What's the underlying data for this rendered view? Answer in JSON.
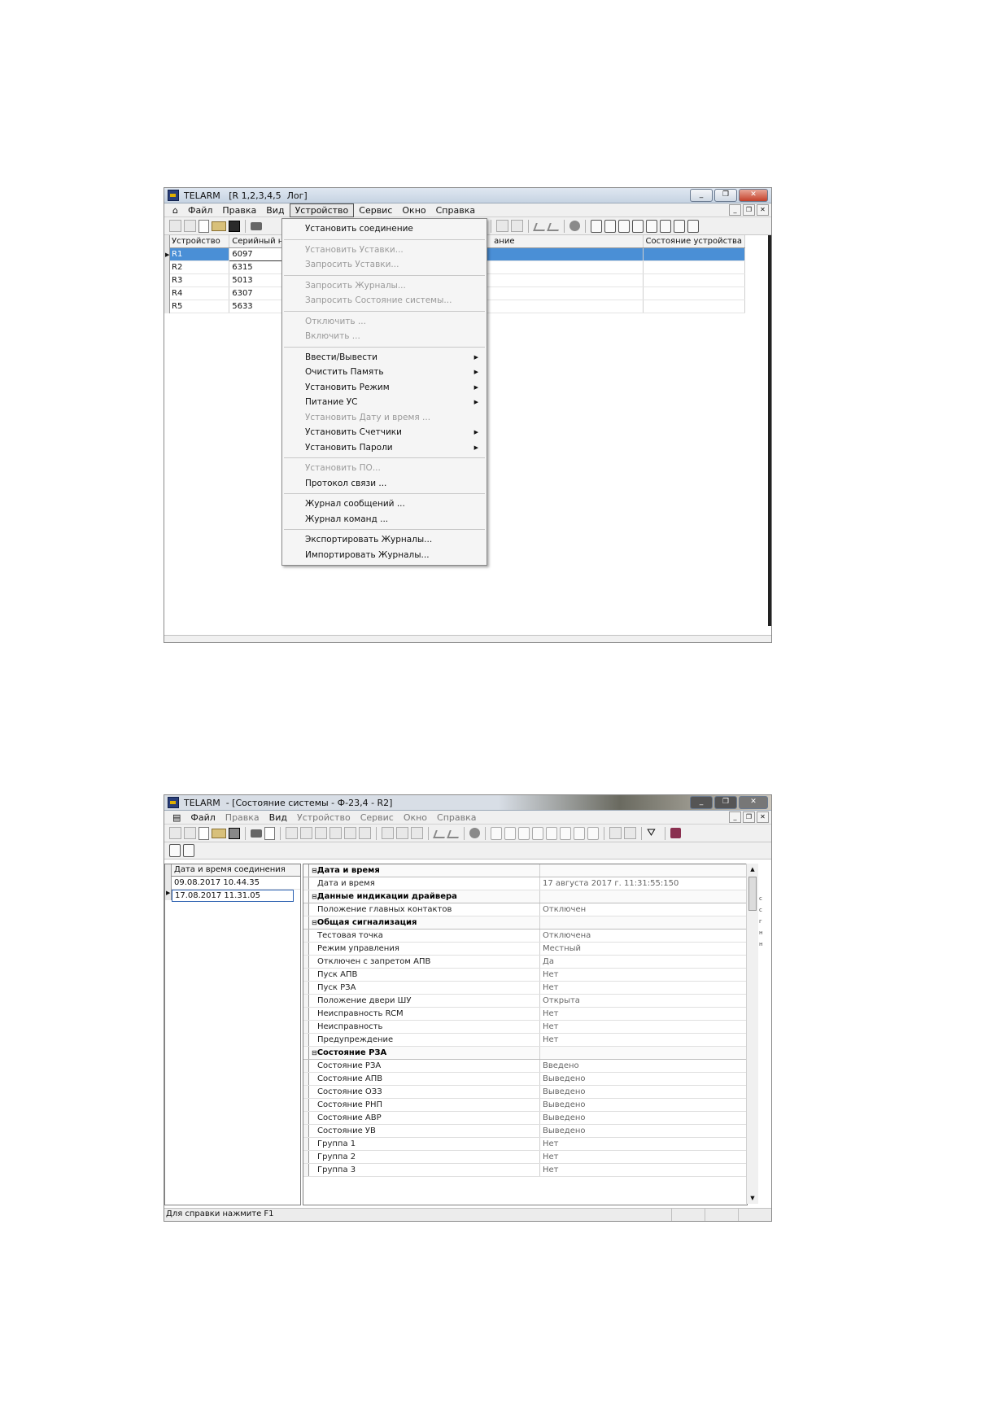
{
  "window1": {
    "title": "TELARM   [R 1,2,3,4,5  Лог]",
    "menu": [
      "Файл",
      "Правка",
      "Вид",
      "Устройство",
      "Сервис",
      "Окно",
      "Справка"
    ],
    "table": {
      "headers": [
        "Устройство",
        "Серийный н",
        "ание",
        "Состояние устройства"
      ],
      "rows": [
        {
          "device": "R1",
          "serial": "6097"
        },
        {
          "device": "R2",
          "serial": "6315"
        },
        {
          "device": "R3",
          "serial": "5013"
        },
        {
          "device": "R4",
          "serial": "6307"
        },
        {
          "device": "R5",
          "serial": "5633"
        }
      ]
    },
    "dropdown": [
      {
        "label": "Установить соединение",
        "disabled": false,
        "submenu": false
      },
      {
        "sep": true
      },
      {
        "label": "Установить Уставки...",
        "disabled": true,
        "submenu": false
      },
      {
        "label": "Запросить Уставки...",
        "disabled": true,
        "submenu": false
      },
      {
        "sep": true
      },
      {
        "label": "Запросить Журналы...",
        "disabled": true,
        "submenu": false
      },
      {
        "label": "Запросить Состояние системы...",
        "disabled": true,
        "submenu": false
      },
      {
        "sep": true
      },
      {
        "label": "Отключить ...",
        "disabled": true,
        "submenu": false
      },
      {
        "label": "Включить ...",
        "disabled": true,
        "submenu": false
      },
      {
        "sep": true
      },
      {
        "label": "Ввести/Вывести",
        "disabled": false,
        "submenu": true
      },
      {
        "label": "Очистить Память",
        "disabled": false,
        "submenu": true
      },
      {
        "label": "Установить Режим",
        "disabled": false,
        "submenu": true
      },
      {
        "label": "Питание УС",
        "disabled": false,
        "submenu": true
      },
      {
        "label": "Установить Дату и время ...",
        "disabled": true,
        "submenu": false
      },
      {
        "label": "Установить Счетчики",
        "disabled": false,
        "submenu": true
      },
      {
        "label": "Установить Пароли",
        "disabled": false,
        "submenu": true
      },
      {
        "sep": true
      },
      {
        "label": "Установить ПО...",
        "disabled": true,
        "submenu": false
      },
      {
        "label": "Протокол связи ...",
        "disabled": false,
        "submenu": false
      },
      {
        "sep": true
      },
      {
        "label": "Журнал сообщений ...",
        "disabled": false,
        "submenu": false
      },
      {
        "label": "Журнал команд ...",
        "disabled": false,
        "submenu": false
      },
      {
        "sep": true
      },
      {
        "label": "Экспортировать Журналы...",
        "disabled": false,
        "submenu": false
      },
      {
        "label": "Импортировать Журналы...",
        "disabled": false,
        "submenu": false
      }
    ]
  },
  "window2": {
    "title": "TELARM  - [Состояние системы - Ф-23,4 - R2]",
    "menu": [
      "Файл",
      "Правка",
      "Вид",
      "Устройство",
      "Сервис",
      "Окно",
      "Справка"
    ],
    "connections_header": "Дата и время соединения",
    "connections": [
      "09.08.2017 10.44.35",
      "17.08.2017 11.31.05"
    ],
    "properties": [
      {
        "name": "Дата и время",
        "cat": true
      },
      {
        "name": "Дата и время",
        "value": "17 августа 2017 г. 11:31:55:150"
      },
      {
        "name": "Данные индикации драйвера",
        "cat": true
      },
      {
        "name": "Положение главных контактов",
        "value": "Отключен"
      },
      {
        "name": "Общая сигнализация",
        "cat": true
      },
      {
        "name": "Тестовая точка",
        "value": "Отключена"
      },
      {
        "name": "Режим управления",
        "value": "Местный"
      },
      {
        "name": "Отключен с запретом АПВ",
        "value": "Да"
      },
      {
        "name": "Пуск АПВ",
        "value": "Нет"
      },
      {
        "name": "Пуск РЗА",
        "value": "Нет"
      },
      {
        "name": "Положение двери ШУ",
        "value": "Открыта"
      },
      {
        "name": "Неисправность RCM",
        "value": "Нет"
      },
      {
        "name": "Неисправность",
        "value": "Нет"
      },
      {
        "name": "Предупреждение",
        "value": "Нет"
      },
      {
        "name": "Состояние РЗА",
        "cat": true
      },
      {
        "name": "Состояние РЗА",
        "value": "Введено"
      },
      {
        "name": "Состояние АПВ",
        "value": "Выведено"
      },
      {
        "name": "Состояние ОЗЗ",
        "value": "Выведено"
      },
      {
        "name": "Состояние РНП",
        "value": "Выведено"
      },
      {
        "name": "Состояние АВР",
        "value": "Выведено"
      },
      {
        "name": "Состояние УВ",
        "value": "Выведено"
      },
      {
        "name": "Группа 1",
        "value": "Нет"
      },
      {
        "name": "Группа 2",
        "value": "Нет"
      },
      {
        "name": "Группа 3",
        "value": "Нет"
      }
    ],
    "status": "Для справки нажмите F1"
  }
}
